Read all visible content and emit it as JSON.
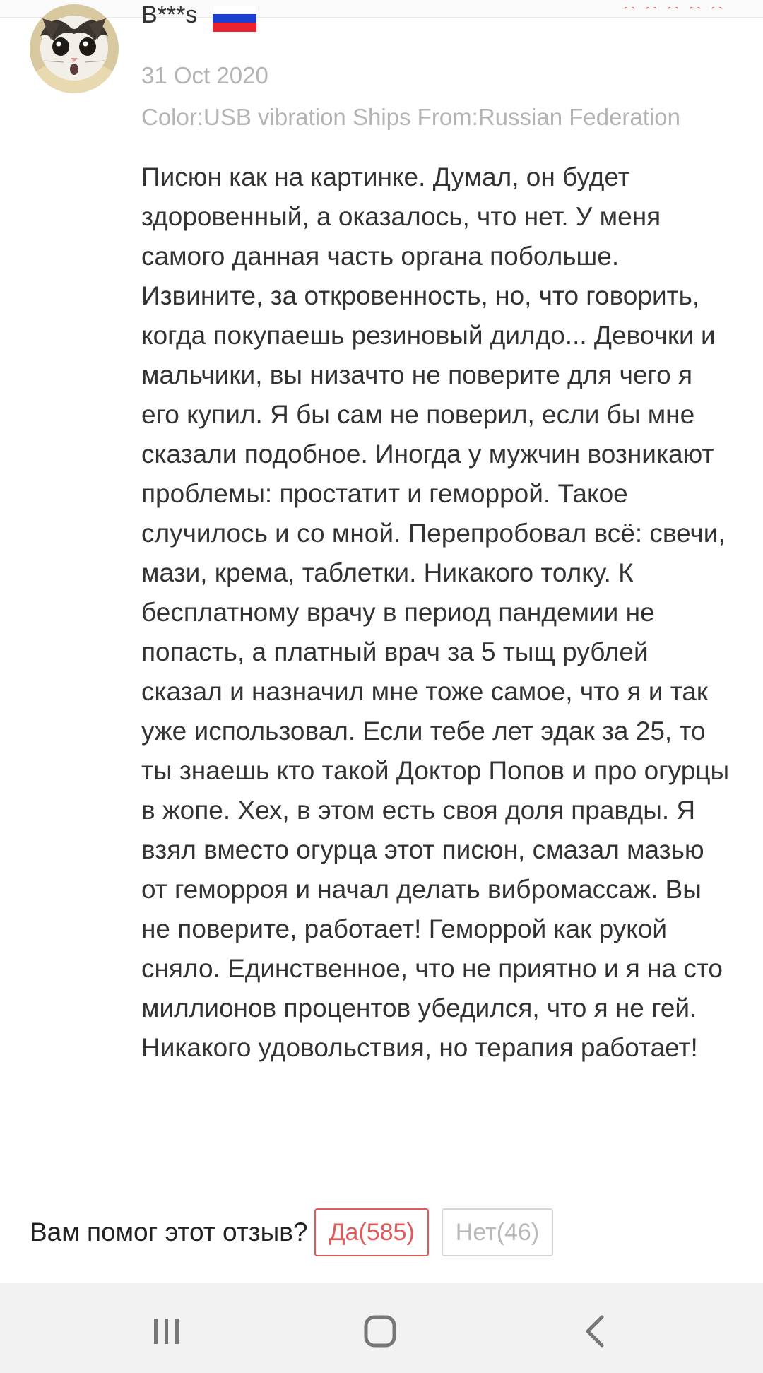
{
  "reviewer": {
    "name": "B***s",
    "country_flag": "russia-flag",
    "flag_colors": [
      "#ffffff",
      "#1c3fd0",
      "#e8232d"
    ],
    "rating_stars": "★★★★★",
    "star_color": "#f26b5b"
  },
  "review": {
    "date": "31 Oct 2020",
    "meta": "Color:USB vibration Ships From:Russian Federation",
    "text": "Писюн как на картинке. Думал, он будет здоровенный, а оказалось, что нет. У меня самого данная часть органа побольше. Извините, за откровенность, но, что говорить, когда покупаешь резиновый дилдо... Девочки и мальчики, вы низачто не поверите для чего я его купил. Я бы сам не поверил, если бы мне сказали подобное. Иногда у мужчин возникают проблемы: простатит и геморрой. Такое случилось и со мной. Перепробовал всё: свечи, мази, крема, таблетки. Никакого толку. К бесплатному врачу в период пандемии не попасть, а платный врач за 5 тыщ рублей сказал и назначил мне тоже самое, что я и так уже использовал. Если тебе лет эдак за 25, то ты знаешь кто такой Доктор Попов и про огурцы в жопе. Хех, в этом есть своя доля правды. Я взял вместо огурца этот писюн, смазал мазью от геморроя и начал делать вибромассаж. Вы не поверите, работает! Геморрой как рукой сняло. Единственное, что не приятно и я на сто миллионов процентов убедился, что я не гей. Никакого удовольствия, но терапия работает!"
  },
  "helpful": {
    "question": "Вам помог этот отзыв?",
    "yes_label": "Да(585)",
    "no_label": "Нет(46)"
  },
  "nav": {
    "recents_icon": "recents-icon",
    "home_icon": "home-icon",
    "back_icon": "back-icon"
  }
}
